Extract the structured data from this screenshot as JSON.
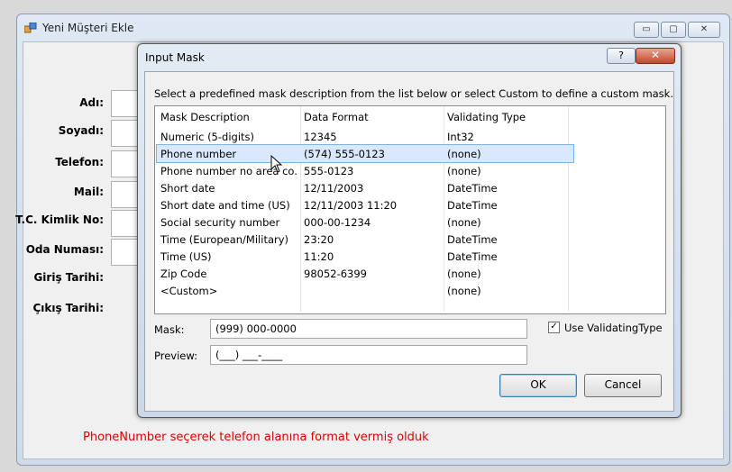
{
  "background_window": {
    "title": "Yeni Müşteri Ekle",
    "minimize": "▭",
    "maximize": "▢",
    "close": "✕",
    "field_labels": [
      "Adı:",
      "Soyadı:",
      "Telefon:",
      "Mail:",
      "T.C. Kimlik No:",
      "Oda Numası:",
      "Giriş Tarihi:",
      "Çıkış Tarihi:"
    ]
  },
  "caption": "PhoneNumber seçerek telefon alanına format vermiş olduk",
  "dialog": {
    "title": "Input Mask",
    "help": "?",
    "close": "✕",
    "instruction": "Select a predefined mask description from the list below or select Custom to define a custom mask.",
    "columns": [
      "Mask Description",
      "Data Format",
      "Validating Type"
    ],
    "rows": [
      {
        "description": "Numeric (5-digits)",
        "format": "12345",
        "type": "Int32"
      },
      {
        "description": "Phone number",
        "format": "(574) 555-0123",
        "type": "(none)"
      },
      {
        "description": "Phone number no area co...",
        "format": "555-0123",
        "type": "(none)"
      },
      {
        "description": "Short date",
        "format": "12/11/2003",
        "type": "DateTime"
      },
      {
        "description": "Short date and time (US)",
        "format": "12/11/2003 11:20",
        "type": "DateTime"
      },
      {
        "description": "Social security number",
        "format": "000-00-1234",
        "type": "(none)"
      },
      {
        "description": "Time (European/Military)",
        "format": "23:20",
        "type": "DateTime"
      },
      {
        "description": "Time (US)",
        "format": "11:20",
        "type": "DateTime"
      },
      {
        "description": "Zip Code",
        "format": "98052-6399",
        "type": "(none)"
      },
      {
        "description": "<Custom>",
        "format": "",
        "type": "(none)"
      }
    ],
    "selected_row": 1,
    "mask_label": "Mask:",
    "mask_value": "(999) 000-0000",
    "preview_label": "Preview:",
    "preview_value": "(___) ___-____",
    "use_validating_label": "Use ValidatingType",
    "use_validating_checked": true,
    "ok_label": "OK",
    "cancel_label": "Cancel"
  }
}
